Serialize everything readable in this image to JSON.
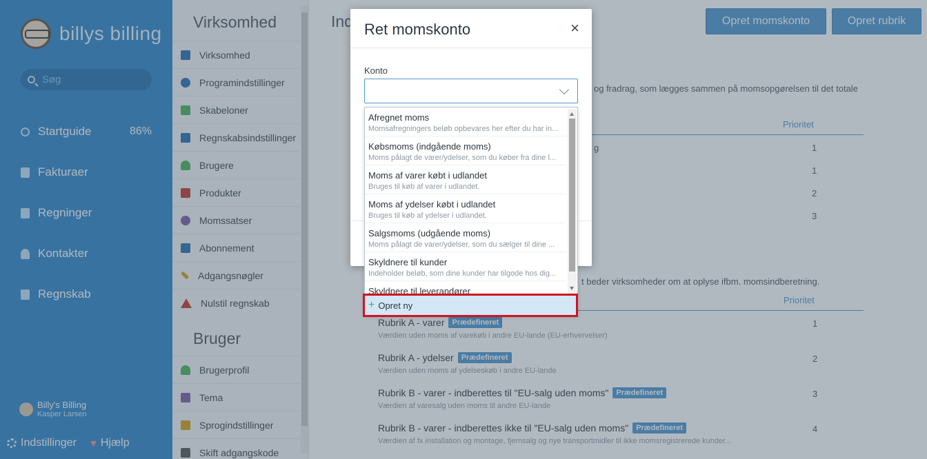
{
  "app": {
    "logo_text": "billys billing",
    "brand_color": "#2f86c8"
  },
  "sidebar": {
    "search_placeholder": "Søg",
    "nav": [
      {
        "label": "Startguide",
        "badge": "86%",
        "icon": "progress-ring-icon"
      },
      {
        "label": "Fakturaer",
        "icon": "invoice-icon"
      },
      {
        "label": "Regninger",
        "icon": "bill-icon"
      },
      {
        "label": "Kontakter",
        "icon": "contacts-icon"
      },
      {
        "label": "Regnskab",
        "icon": "accounting-icon"
      }
    ],
    "user": {
      "org": "Billy's Billing",
      "name": "Kasper Larsen"
    },
    "bottom": {
      "settings": "Indstillinger",
      "help": "Hjælp"
    }
  },
  "settings": {
    "section1_title": "Virksomhed",
    "section1_items": [
      {
        "label": "Virksomhed",
        "icon_color": "#2a6fb0"
      },
      {
        "label": "Programindstillinger",
        "icon_color": "#2a6fb0"
      },
      {
        "label": "Skabeloner",
        "icon_color": "#49b35c"
      },
      {
        "label": "Regnskabsindstillinger",
        "icon_color": "#2a6fb0"
      },
      {
        "label": "Brugere",
        "icon_color": "#49b35c"
      },
      {
        "label": "Produkter",
        "icon_color": "#c0392b"
      },
      {
        "label": "Momssatser",
        "icon_color": "#7b5ea7"
      },
      {
        "label": "Abonnement",
        "icon_color": "#2a6fb0"
      },
      {
        "label": "Adgangsnøgler",
        "icon_color": "#d4a017"
      },
      {
        "label": "Nulstil regnskab",
        "icon_color": "#c0392b"
      }
    ],
    "section2_title": "Bruger",
    "section2_items": [
      {
        "label": "Brugerprofil",
        "icon_color": "#49b35c"
      },
      {
        "label": "Tema",
        "icon_color": "#7b5ea7"
      },
      {
        "label": "Sprogindstillinger",
        "icon_color": "#d4a017"
      },
      {
        "label": "Skift adgangskode",
        "icon_color": "#555555"
      }
    ]
  },
  "main": {
    "title": "Ind",
    "btn_create_account": "Opret momskonto",
    "btn_create_rubrik": "Opret rubrik",
    "desc1": "og fradrag, som lægges sammen på momsopgørelsen til det totale",
    "col_priority": "Prioritet",
    "row_fragment": "g",
    "priorities1": [
      "1",
      "1",
      "2",
      "3"
    ],
    "desc2": "t beder virksomheder om at oplyse ifbm. momsindberetning.",
    "col_priority2": "Prioritet",
    "rubrikker": [
      {
        "title": "Rubrik A - varer",
        "badge": "Prædefineret",
        "desc": "Værdien uden moms af varekøb i andre EU-lande (EU-erhvervelser)",
        "priority": "1"
      },
      {
        "title": "Rubrik A - ydelser",
        "badge": "Prædefineret",
        "desc": "Værdien uden moms af ydelseskøb i andre EU-lande",
        "priority": "2"
      },
      {
        "title": "Rubrik B - varer - indberettes til \"EU-salg uden moms\"",
        "badge": "Prædefineret",
        "desc": "Værdien af varesalg uden moms til andre EU-lande",
        "priority": "3"
      },
      {
        "title": "Rubrik B - varer - indberettes ikke til \"EU-salg uden moms\"",
        "badge": "Prædefineret",
        "desc": "Værdien af fx installation og montage, fjernsalg og nye transportmidler til ikke momsregistrerede kunder...",
        "priority": "4"
      }
    ]
  },
  "modal": {
    "title": "Ret momskonto",
    "close": "×",
    "field_label": "Konto",
    "field_value": "",
    "options": [
      {
        "title": "Afregnet moms",
        "desc": "Momsafregningers beløb opbevares her efter du har in..."
      },
      {
        "title": "Købsmoms (indgående moms)",
        "desc": "Moms pålagt de varer/ydelser, som du køber fra dine l..."
      },
      {
        "title": "Moms af varer købt i udlandet",
        "desc": "Bruges til køb af varer i udlandet."
      },
      {
        "title": "Moms af ydelser købt i udlandet",
        "desc": "Bruges til køb af ydelser i udlandet."
      },
      {
        "title": "Salgsmoms (udgående moms)",
        "desc": "Moms pålagt de varer/ydelser, som du sælger til dine ..."
      },
      {
        "title": "Skyldnere til kunder",
        "desc": "Indeholder beløb, som dine kunder har tilgode hos dig..."
      },
      {
        "title": "Skyldnere til leverandører",
        "desc": ""
      }
    ],
    "create_new": "Opret ny"
  }
}
